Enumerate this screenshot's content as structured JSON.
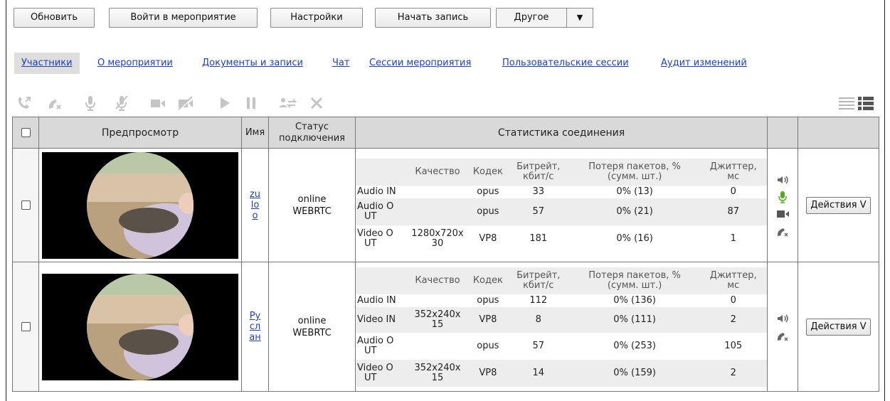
{
  "toolbar": {
    "refresh": "Обновить",
    "join": "Войти в мероприятие",
    "settings": "Настройки",
    "record": "Начать запись",
    "other": "Другое"
  },
  "tabs": [
    {
      "label": "Участники",
      "active": true
    },
    {
      "label": "О мероприятии"
    },
    {
      "label": "Документы и записи"
    },
    {
      "label": "Чат"
    },
    {
      "label": "Сессии мероприятия"
    },
    {
      "label": "Пользовательские сессии"
    },
    {
      "label": "Аудит изменений"
    }
  ],
  "columns": {
    "preview": "Предпросмотр",
    "name": "Имя",
    "status_line1": "Статус",
    "status_line2": "подключения",
    "stats": "Статистика соединения"
  },
  "stats_headers": {
    "quality": "Качество",
    "codec": "Кодек",
    "bitrate_1": "Битрейт,",
    "bitrate_2": "кбит/с",
    "loss_1": "Потеря пакетов, %",
    "loss_2": "(сумм. шт.)",
    "jitter_1": "Джиттер,",
    "jitter_2": "мс"
  },
  "colors": {
    "link": "#1a3fc9",
    "header_bg": "#d9d9d9",
    "mic_active": "#4caf1a"
  },
  "participants": [
    {
      "name_lines": [
        "zu",
        "lo",
        "o"
      ],
      "status": "online",
      "transport": "WEBRTC",
      "action": "Действия V",
      "icons": [
        "speaker-icon",
        "mic-icon",
        "camera-icon",
        "hangup-icon"
      ],
      "streams": [
        {
          "label": [
            "Audio IN"
          ],
          "quality": [
            "",
            ""
          ],
          "codec": "opus",
          "bitrate": "33",
          "loss": "0% (13)",
          "jitter": "0"
        },
        {
          "label": [
            "Audio O",
            "UT"
          ],
          "quality": [
            "",
            ""
          ],
          "codec": "opus",
          "bitrate": "57",
          "loss": "0% (21)",
          "jitter": "87"
        },
        {
          "label": [
            "Video O",
            "UT"
          ],
          "quality": [
            "1280x720x",
            "30"
          ],
          "codec": "VP8",
          "bitrate": "181",
          "loss": "0% (16)",
          "jitter": "1"
        }
      ]
    },
    {
      "name_lines": [
        "Ру",
        "сл",
        "ан"
      ],
      "status": "online",
      "transport": "WEBRTC",
      "action": "Действия V",
      "icons": [
        "speaker-icon",
        "hangup-icon"
      ],
      "streams": [
        {
          "label": [
            "Audio IN"
          ],
          "quality": [
            "",
            ""
          ],
          "codec": "opus",
          "bitrate": "112",
          "loss": "0% (136)",
          "jitter": "0"
        },
        {
          "label": [
            "Video IN"
          ],
          "quality": [
            "352x240x",
            "15"
          ],
          "codec": "VP8",
          "bitrate": "8",
          "loss": "0% (111)",
          "jitter": "2"
        },
        {
          "label": [
            "Audio O",
            "UT"
          ],
          "quality": [
            "",
            ""
          ],
          "codec": "opus",
          "bitrate": "57",
          "loss": "0% (253)",
          "jitter": "105"
        },
        {
          "label": [
            "Video O",
            "UT"
          ],
          "quality": [
            "352x240x",
            "15"
          ],
          "codec": "VP8",
          "bitrate": "14",
          "loss": "0% (159)",
          "jitter": "2"
        }
      ]
    }
  ]
}
